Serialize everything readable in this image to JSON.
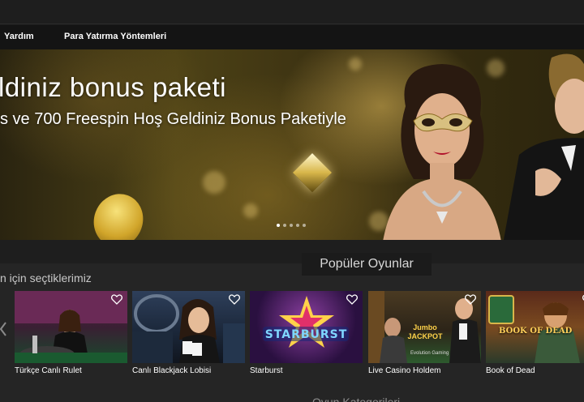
{
  "nav": {
    "help": "Yardım",
    "payment_methods": "Para Yatırma Yöntemleri"
  },
  "banner": {
    "headline": "ldiniz bonus paketi",
    "subline": "s ve 700 Freespin Hoş Geldiniz Bonus Paketiyle",
    "slides_total": 5,
    "active_slide": 1
  },
  "sections": {
    "popular_title": "Popüler Oyunlar",
    "picks_title": "n için seçtiklerimiz",
    "bottom_partial": "Oyun Kategorileri"
  },
  "games": [
    {
      "name": "Türkçe Canlı Rulet"
    },
    {
      "name": "Canlı Blackjack Lobisi"
    },
    {
      "name": "Starburst",
      "logo": "STARBURST"
    },
    {
      "name": "Live Casino Holdem",
      "logo": "Jumbo JACKPOT",
      "provider": "Evolution Gaming"
    },
    {
      "name": "Book of Dead",
      "logo": "BOOK OF DEAD"
    }
  ],
  "colors": {
    "background": "#1b1b1b",
    "nav_bg": "#141414",
    "section_bg": "#252525",
    "accent_gold": "#d8b64a"
  },
  "icons": {
    "favorite": "heart-outline-icon",
    "carousel_prev": "chevron-left-icon"
  }
}
